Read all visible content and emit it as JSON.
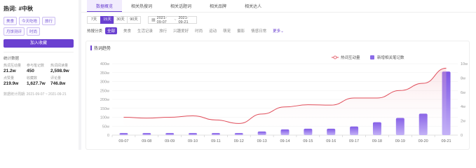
{
  "sidebar": {
    "topic_label": "热词:",
    "topic_name": "#中秋",
    "tags": [
      "美食",
      "今天吃啥",
      "旅行",
      "月饼测评",
      "时尚"
    ],
    "join_button": "加入收藏",
    "stats_title": "统计数据",
    "stats": [
      {
        "label": "热词互动量",
        "value": "21.2w"
      },
      {
        "label": "参与笔记数",
        "value": "450"
      },
      {
        "label": "热词阅读量",
        "value": "2,598.9w"
      },
      {
        "label": "点赞量",
        "value": "219.9w"
      },
      {
        "label": "收藏数",
        "value": "1,627.7w"
      },
      {
        "label": "评论量",
        "value": "746.8w"
      }
    ],
    "range_note": "数据统计周期: 2021-09-07 ~ 2021-09-21"
  },
  "tabs": [
    {
      "label": "数据概览",
      "active": true
    },
    {
      "label": "相关热搜词",
      "active": false
    },
    {
      "label": "相关话题词",
      "active": false
    },
    {
      "label": "相关品牌",
      "active": false
    },
    {
      "label": "相关达人",
      "active": false
    }
  ],
  "range_buttons": [
    {
      "label": "7天",
      "active": false
    },
    {
      "label": "15天",
      "active": true
    },
    {
      "label": "30天",
      "active": false
    },
    {
      "label": "90天",
      "active": false
    }
  ],
  "date_range": {
    "start": "2021-09-07",
    "end": "2021-09-21"
  },
  "categories": {
    "label": "热搜分类",
    "items": [
      {
        "label": "全部",
        "active": true
      },
      {
        "label": "美食",
        "active": false
      },
      {
        "label": "生活记录",
        "active": false
      },
      {
        "label": "旅行",
        "active": false
      },
      {
        "label": "兴趣爱好",
        "active": false
      },
      {
        "label": "时尚",
        "active": false
      },
      {
        "label": "运动",
        "active": false
      },
      {
        "label": "萌宠",
        "active": false
      },
      {
        "label": "摄影",
        "active": false
      },
      {
        "label": "情感日常",
        "active": false
      }
    ],
    "more": "更多"
  },
  "chart_section_title": "热词趋势",
  "chart_data": {
    "type": "bar",
    "categories": [
      "09-07",
      "09-08",
      "09-09",
      "09-10",
      "09-11",
      "09-12",
      "09-13",
      "09-14",
      "09-15",
      "09-16",
      "09-17",
      "09-18",
      "09-19",
      "09-20",
      "09-21"
    ],
    "series": [
      {
        "name": "热词互动量",
        "type": "line",
        "axis": "left",
        "values": [
          100,
          95,
          100,
          108,
          85,
          65,
          118,
          158,
          170,
          168,
          208,
          208,
          250,
          290,
          375
        ],
        "color": "#e04d5a"
      },
      {
        "name": "新增相关笔记数",
        "type": "bar",
        "axis": "right",
        "values": [
          0.3,
          0.3,
          0.3,
          0.3,
          0.3,
          0.3,
          0.5,
          0.8,
          0.9,
          0.9,
          1.2,
          1.8,
          2.4,
          3.0,
          8.9
        ],
        "color": "#8b6be8"
      }
    ],
    "y_left": {
      "ticks": [
        "0",
        "50w",
        "100w",
        "150w",
        "200w",
        "250w",
        "300w",
        "350w",
        "400w"
      ],
      "max": 400
    },
    "y_right": {
      "ticks": [
        "0",
        "2w",
        "4w",
        "6w",
        "8w",
        "10w"
      ],
      "max": 10
    },
    "legend_position": "top-right",
    "grid": true
  }
}
